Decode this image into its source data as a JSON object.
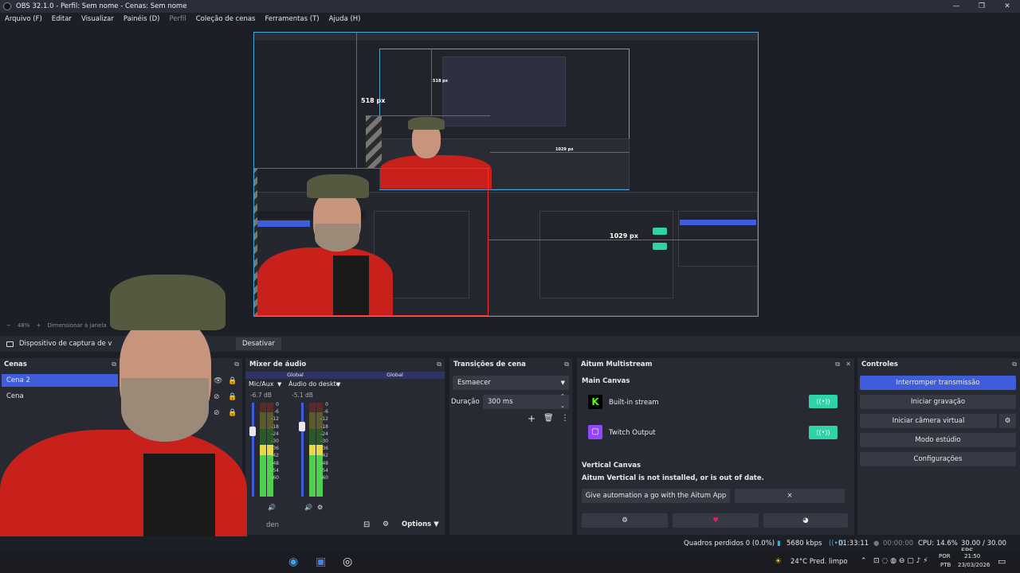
{
  "window": {
    "title": "OBS 32.1.0 - Perfil: Sem nome - Cenas: Sem nome",
    "controls": {
      "minimize": "—",
      "maximize": "❐",
      "close": "✕"
    }
  },
  "menu": [
    "Arquivo (F)",
    "Editar",
    "Visualizar",
    "Painéis (D)",
    "Perfil",
    "Coleção de cenas",
    "Ferramentas (T)",
    "Ajuda (H)"
  ],
  "preview": {
    "label_height": "518 px",
    "label_width": "1029 px",
    "nested_label_height": "518 px",
    "nested_label_width": "1029 px"
  },
  "zoombar": {
    "minus": "−",
    "zoom": "48%",
    "plus": "+",
    "mode": "Dimensionar à janela"
  },
  "source_toolbar": {
    "source_name": "Dispositivo de captura de v",
    "deactivate": "Desativar"
  },
  "scenes": {
    "title": "Cenas",
    "items": [
      {
        "label": "Cena 2",
        "selected": true
      },
      {
        "label": "Cena",
        "selected": false
      }
    ]
  },
  "mixer": {
    "title": "Mixer de áudio",
    "channels": [
      {
        "group": "Global",
        "name": "Mic/Aux",
        "db": "-6.7 dB",
        "level": 0.55
      },
      {
        "group": "Global",
        "name": "Áudio do deskto",
        "db": "-5.1 dB",
        "level": 0.55
      }
    ],
    "scale": [
      "0",
      "-6",
      "-12",
      "-18",
      "-24",
      "-30",
      "-36",
      "-42",
      "-48",
      "-54",
      "-60"
    ],
    "hidden_label": "den",
    "options": "Options"
  },
  "transitions": {
    "title": "Transições de cena",
    "transition": "Esmaecer",
    "duration_label": "Duração",
    "duration_value": "300 ms"
  },
  "aitum": {
    "title": "Aitum Multistream",
    "main_canvas": "Main Canvas",
    "outputs": [
      {
        "name": "Built-in stream",
        "icon": "kick-icon",
        "color": "#53fc18"
      },
      {
        "name": "Twitch Output",
        "icon": "twitch-icon",
        "color": "#9146ff"
      }
    ],
    "vertical_canvas": "Vertical Canvas",
    "warning": "Aitum Vertical is not installed, or is out of date.",
    "automation_button": "Give automation a go with the Aitum App",
    "dismiss": "×"
  },
  "controls": {
    "title": "Controles",
    "buttons": [
      "Interromper transmissão",
      "Iniciar gravação",
      "Iniciar câmera virtual",
      "Modo estúdio",
      "Configurações"
    ]
  },
  "status": {
    "dropped": "Quadros perdidos 0 (0.0%)",
    "bitrate": "5680 kbps",
    "stream_time": "01:33:11",
    "rec_time": "00:00:00",
    "cpu": "CPU: 14.6%",
    "fps": "30.00 / 30.00 FPS"
  },
  "taskbar": {
    "weather": "24°C  Pred. limpo",
    "lang_top": "POR",
    "lang_bottom": "PTB",
    "time": "21:50",
    "date": "23/03/2026"
  },
  "colors": {
    "accent": "#3f5cdb",
    "toggle": "#2fd3a8",
    "heart": "#e0245e",
    "preview_border": "#4ea6d8"
  }
}
